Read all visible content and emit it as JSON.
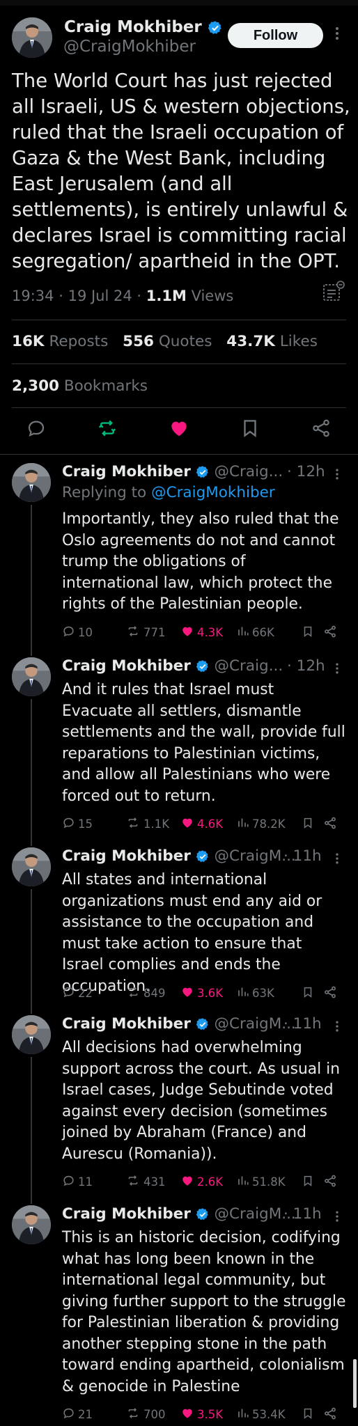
{
  "main_tweet": {
    "author_name": "Craig Mokhiber",
    "handle": "@CraigMokhiber",
    "follow_label": "Follow",
    "text": "The World Court has just rejected all Israeli, US & western objections, ruled that the Israeli occupation of Gaza & the West Bank, including East Jerusalem (and all settlements), is entirely unlawful & declares Israel is committing racial segregation/ apartheid in the OPT.",
    "time": "19:34",
    "date": "19 Jul 24",
    "views_count": "1.1M",
    "views_label": "Views",
    "reposts_count": "16K",
    "reposts_label": "Reposts",
    "quotes_count": "556",
    "quotes_label": "Quotes",
    "likes_count": "43.7K",
    "likes_label": "Likes",
    "bookmarks_count": "2,300",
    "bookmarks_label": "Bookmarks"
  },
  "replies": [
    {
      "author_name": "Craig Mokhiber",
      "handle": "@Craig...",
      "time": "· 12h",
      "replying_prefix": "Replying to",
      "replying_to": "@CraigMokhiber",
      "text": "Importantly, they also ruled that the Oslo agreements do not and cannot trump the obligations of international law, which protect the rights of the Palestinian people.",
      "replies": "10",
      "reposts": "771",
      "likes": "4.3K",
      "views": "66K"
    },
    {
      "author_name": "Craig Mokhiber",
      "handle": "@Craig...",
      "time": "· 12h",
      "text": "And it rules that Israel must Evacuate all settlers, dismantle settlements and the wall, provide full reparations to Palestinian victims, and allow all Palestinians who were forced out to return.",
      "replies": "15",
      "reposts": "1.1K",
      "likes": "4.6K",
      "views": "78.2K"
    },
    {
      "author_name": "Craig Mokhiber",
      "handle": "@CraigM...",
      "time": "· 11h",
      "text": "All states and international organizations must end any aid or assistance to the occupation and must take action to ensure that Israel complies and ends the occupation.",
      "replies": "22",
      "reposts": "849",
      "likes": "3.6K",
      "views": "63K"
    },
    {
      "author_name": "Craig Mokhiber",
      "handle": "@CraigM...",
      "time": "· 11h",
      "text": "All decisions had overwhelming support across the court. As usual in Israel cases, Judge Sebutinde voted against every decision (sometimes joined by Abraham (France) and Aurescu (Romania)).",
      "replies": "11",
      "reposts": "431",
      "likes": "2.6K",
      "views": "51.8K"
    },
    {
      "author_name": "Craig Mokhiber",
      "handle": "@CraigM...",
      "time": "· 11h",
      "text": "This is an historic decision, codifying what has long been known in the international legal community, but giving further support to the struggle for Palestinian liberation & providing another stepping stone in the path toward ending apartheid, colonialism & genocide in Palestine",
      "replies": "21",
      "reposts": "700",
      "likes": "3.5K",
      "views": "53.4K"
    }
  ],
  "colors": {
    "background": "#000000",
    "text_primary": "#e7e9ea",
    "text_secondary": "#71767b",
    "link": "#1d9bf0",
    "verified": "#1d9bf0",
    "like": "#f91880",
    "repost": "#00ba7c"
  }
}
